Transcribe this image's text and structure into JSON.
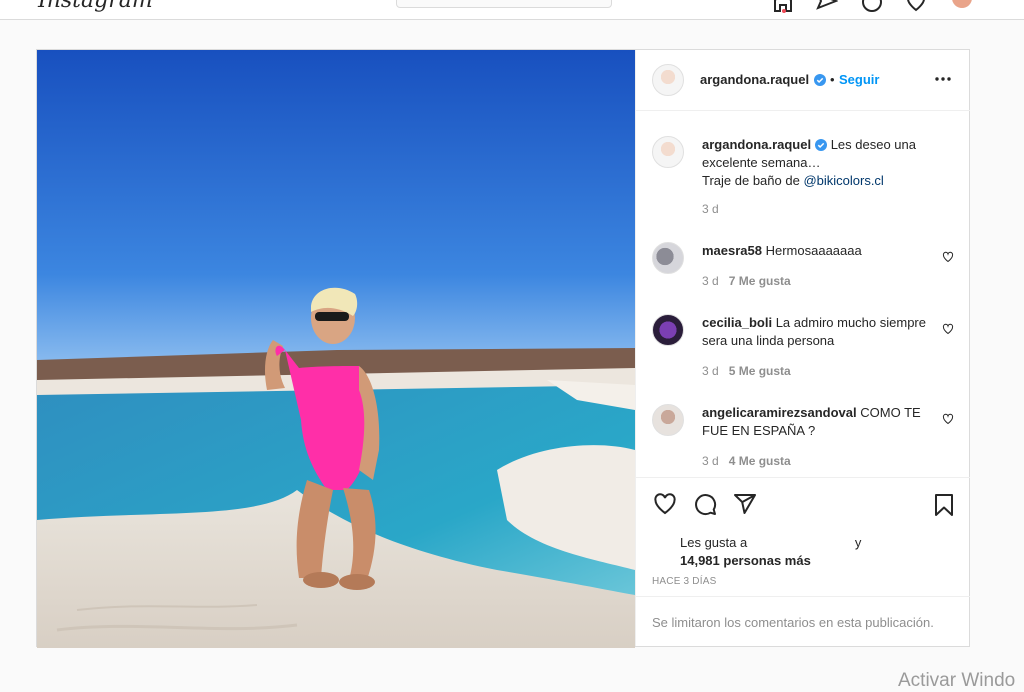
{
  "nav": {
    "logo": "Instagram",
    "search_placeholder": "",
    "icons": [
      "home-icon",
      "direct-icon",
      "explore-icon",
      "activity-icon"
    ]
  },
  "post": {
    "owner": {
      "username": "argandona.raquel",
      "verified": true
    },
    "header_dot": "•",
    "follow_label": "Seguir",
    "more_label": "…",
    "caption": {
      "username": "argandona.raquel",
      "text_line1": " Les deseo una excelente semana…",
      "text_line2_prefix": "Traje de baño de ",
      "mention": "@bikicolors.cl",
      "age": "3 d"
    },
    "comments": [
      {
        "username": "maesra58",
        "text": " Hermosaaaaaaa",
        "age": "3 d",
        "likes": "7 Me gusta"
      },
      {
        "username": "cecilia_boli",
        "text": " La admiro mucho siempre sera una linda persona",
        "age": "3 d",
        "likes": "5 Me gusta"
      },
      {
        "username": "angelicaramirezsandoval",
        "text": " COMO TE FUE EN ESPAÑA ?",
        "age": "3 d",
        "likes": "4 Me gusta"
      }
    ],
    "likes": {
      "prefix": "Les gusta a",
      "suffix": " y",
      "count": "14,981 personas más"
    },
    "time_ago": "HACE 3 DÍAS",
    "comments_limited": "Se limitaron los comentarios en esta publicación."
  },
  "watermark": "Activar Windo",
  "colors": {
    "accent": "#0095f6",
    "verified": "#3897f0",
    "swimsuit": "#ff2fa8",
    "sky": "#1f63c8"
  }
}
